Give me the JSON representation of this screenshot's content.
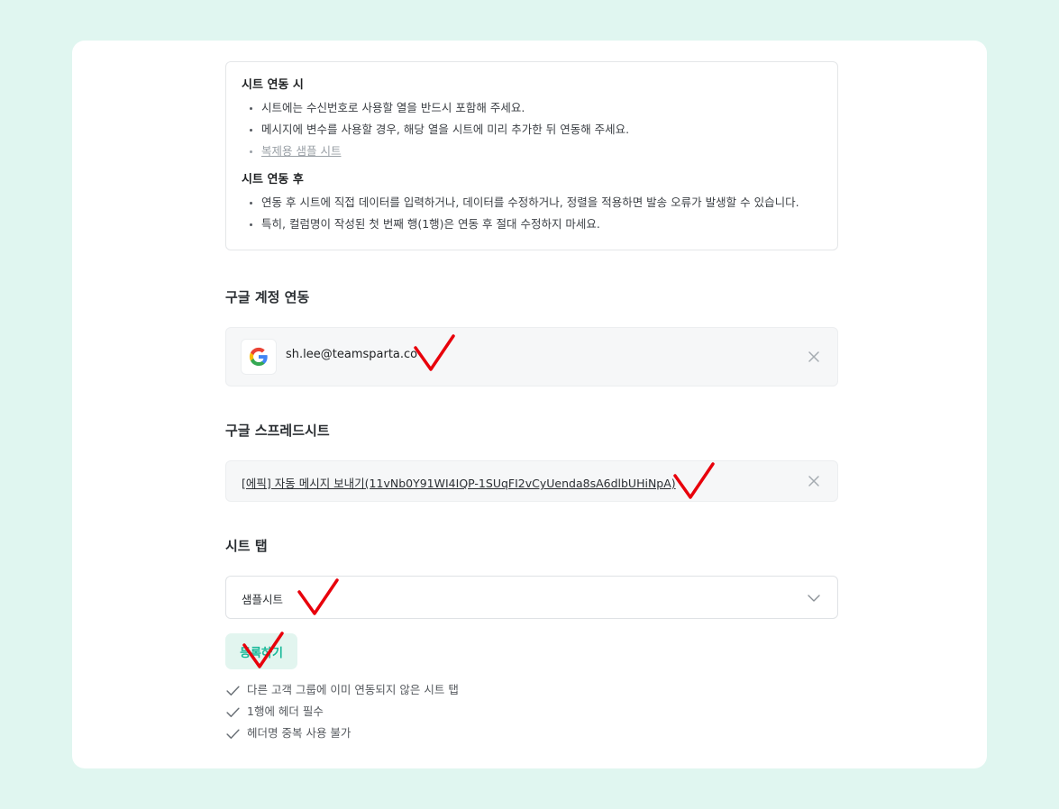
{
  "notice": {
    "before_title": "시트 연동 시",
    "before_items": [
      "시트에는 수신번호로 사용할 열을 반드시 포함해 주세요.",
      "메시지에 변수를 사용할 경우, 해당 열을 시트에 미리 추가한 뒤 연동해 주세요."
    ],
    "sample_link": "복제용 샘플 시트",
    "after_title": "시트 연동 후",
    "after_items": [
      "연동 후 시트에 직접 데이터를 입력하거나, 데이터를 수정하거나, 정렬을 적용하면 발송 오류가 발생할 수 있습니다.",
      "특히, 컬럼명이 작성된 첫 번째 행(1행)은 연동 후 절대 수정하지 마세요."
    ]
  },
  "google_account": {
    "label": "구글 계정 연동",
    "email": "sh.lee@teamsparta.co",
    "logo_icon": "google-logo",
    "remove_icon": "close-icon"
  },
  "spreadsheet": {
    "label": "구글 스프레드시트",
    "link_text": "[에픽] 자동 메시지 보내기(11vNb0Y91WI4IQP-1SUqFI2vCyUenda8sA6dlbUHiNpA)",
    "remove_icon": "close-icon"
  },
  "sheet_tab": {
    "label": "시트 탭",
    "selected": "샘플시트",
    "dropdown_icon": "chevron-down-icon"
  },
  "register_button": "등록하기",
  "requirements": [
    "다른 고객 그룹에 이미 연동되지 않은 시트 탭",
    "1행에 헤더 필수",
    "헤더명 중복 사용 불가"
  ],
  "colors": {
    "background": "#e0f6f0",
    "accent": "#17b898",
    "annotation_mark": "#e8000b"
  }
}
